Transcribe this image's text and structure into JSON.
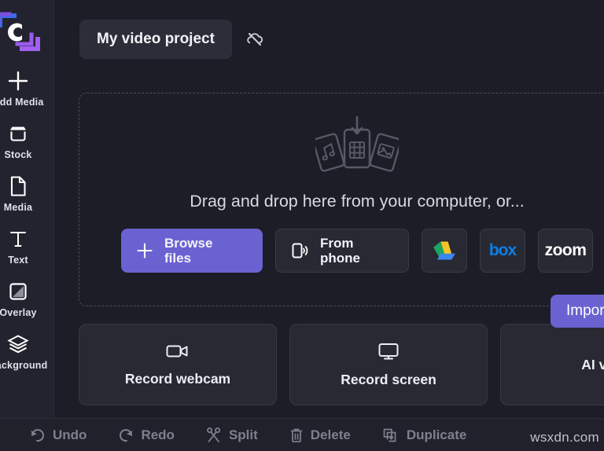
{
  "app": {
    "name": "Clipchamp video editor",
    "background_color": "#1c1d26",
    "accent_color": "#6b62d2",
    "sidebar_color": "#22232e"
  },
  "sidebar": {
    "logo_name": "clipchamp-logo",
    "items": [
      {
        "label": "Add Media",
        "icon": "plus-icon"
      },
      {
        "label": "Stock",
        "icon": "stock-icon"
      },
      {
        "label": "Media",
        "icon": "media-file-icon"
      },
      {
        "label": "Text",
        "icon": "text-icon"
      },
      {
        "label": "Overlay",
        "icon": "overlay-icon"
      },
      {
        "label": "Background",
        "icon": "layers-icon"
      }
    ]
  },
  "header": {
    "project_title": "My video project",
    "sync_icon": "cloud-sync-off-icon"
  },
  "dropzone": {
    "message": "Drag and drop here from your computer, or...",
    "illustration": "media-cards-import-illustration",
    "buttons": [
      {
        "name": "browse-files-button",
        "line1": "Browse",
        "line2": "files",
        "icon": "plus-icon",
        "style": "primary"
      },
      {
        "name": "from-phone-button",
        "line1": "From",
        "line2": "phone",
        "icon": "phone-signal-icon",
        "style": "secondary"
      },
      {
        "name": "google-drive-button",
        "label": "",
        "icon": "google-drive-icon",
        "style": "icon-only"
      },
      {
        "name": "box-button",
        "label": "box",
        "icon": "box-logo-icon",
        "style": "icon-only"
      },
      {
        "name": "zoom-button",
        "label": "zoom",
        "icon": "zoom-logo-icon",
        "style": "icon-only"
      }
    ]
  },
  "import_button": {
    "label": "Import..."
  },
  "record_cards": [
    {
      "label": "Record webcam",
      "icon": "video-camera-icon"
    },
    {
      "label": "Record screen",
      "icon": "monitor-icon"
    },
    {
      "label": "AI v...",
      "icon": "ai-icon"
    }
  ],
  "toolbar": {
    "items": [
      {
        "label": "Undo",
        "icon": "undo-arrow-icon"
      },
      {
        "label": "Redo",
        "icon": "redo-arrow-icon"
      },
      {
        "label": "Split",
        "icon": "scissors-icon"
      },
      {
        "label": "Delete",
        "icon": "trash-icon"
      },
      {
        "label": "Duplicate",
        "icon": "duplicate-icon"
      }
    ]
  },
  "watermark": {
    "text": "wsxdn.com"
  }
}
